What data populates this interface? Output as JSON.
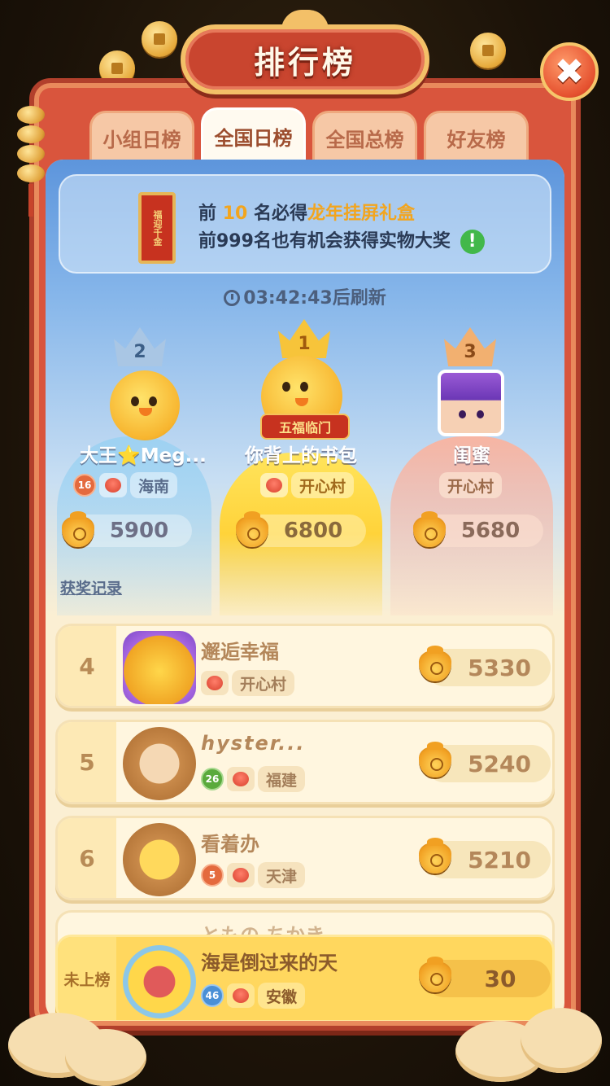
{
  "title": "排行榜",
  "close_label": "✖",
  "tabs": [
    {
      "label": "小组日榜",
      "active": false
    },
    {
      "label": "全国日榜",
      "active": true
    },
    {
      "label": "全国总榜",
      "active": false
    },
    {
      "label": "好友榜",
      "active": false
    }
  ],
  "info": {
    "line1_prefix": "前",
    "line1_num": "10",
    "line1_mid": "名必得",
    "line1_gift": "龙年挂屏礼盒",
    "line2": "前999名也有机会获得实物大奖",
    "scroll_text": "福迎千金",
    "exclaim": "!"
  },
  "timer": "03:42:43后刷新",
  "podium": {
    "first": {
      "rank": "1",
      "name": "你背上的书包",
      "location": "开心村",
      "score": "6800",
      "tag": "五福临门"
    },
    "second": {
      "rank": "2",
      "name": "大王⭐Meg...",
      "level": "16",
      "location": "海南",
      "score": "5900"
    },
    "third": {
      "rank": "3",
      "name": "闺蜜",
      "location": "开心村",
      "score": "5680"
    }
  },
  "award_record": "获奖记录",
  "list": [
    {
      "rank": "4",
      "name": "邂逅幸福",
      "location": "开心村",
      "score": "5330",
      "avatar": "rap-chick"
    },
    {
      "rank": "5",
      "name": "hyster...",
      "level": "26",
      "location": "福建",
      "score": "5240",
      "avatar": "bear-cat"
    },
    {
      "rank": "6",
      "name": "看着办",
      "level": "5",
      "location": "天津",
      "score": "5210",
      "avatar": "bear-chick"
    }
  ],
  "peek_name": "ともの ちかき",
  "me": {
    "rank": "未上榜",
    "name": "海是倒过来的天",
    "level": "46",
    "location": "安徽",
    "score": "30"
  },
  "colors": {
    "frame": "#d9553d",
    "gold": "#f2a51f",
    "panel": "#fbefd3"
  }
}
